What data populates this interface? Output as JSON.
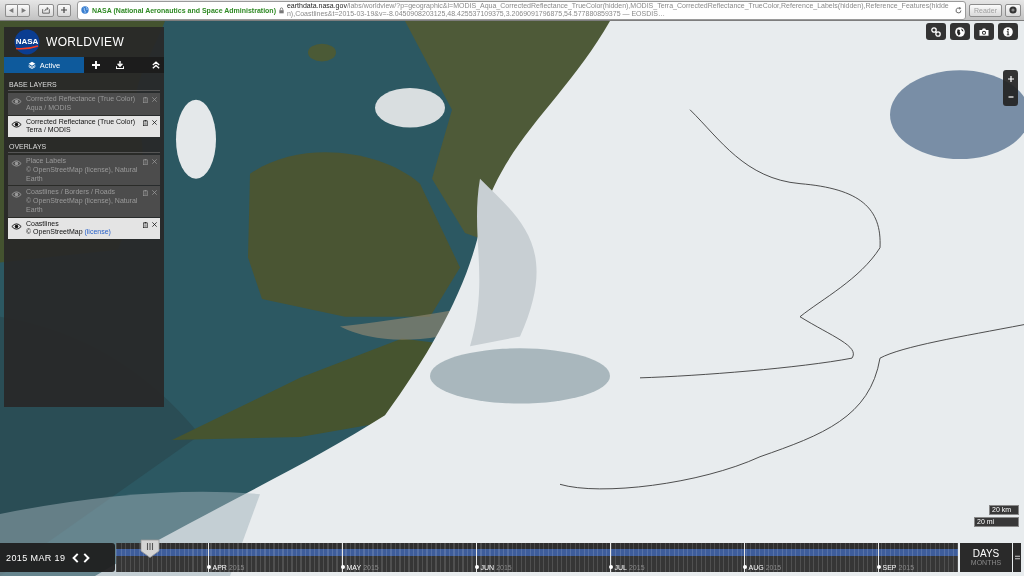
{
  "browser": {
    "site_identity": "NASA (National Aeronautics and Space Administration)",
    "url_domain": "earthdata.nasa.gov",
    "url_path": "/labs/worldview/?p=geographic&l=MODIS_Aqua_CorrectedReflectance_TrueColor(hidden),MODIS_Terra_CorrectedReflectance_TrueColor,Reference_Labels(hidden),Reference_Features(hidden),Coastlines&t=2015-03-19&v=-8.0450908203125,48.425537109375,3.2069091796875,54.577880859375 — EOSDIS…",
    "reader": {
      "label": "Reader",
      "disabled": true
    }
  },
  "app": {
    "logo_text": "NASA",
    "title": "WORLDVIEW"
  },
  "tabs": [
    {
      "kind": "text",
      "label": "Active",
      "selected": true
    },
    {
      "kind": "add",
      "selected": false
    },
    {
      "kind": "download",
      "selected": false
    }
  ],
  "layer_groups": [
    {
      "title": "BASE LAYERS",
      "layers": [
        {
          "name": "Corrected Reflectance (True Color)",
          "source": "Aqua / MODIS",
          "visible": false
        },
        {
          "name": "Corrected Reflectance (True Color)",
          "source": "Terra / MODIS",
          "visible": true
        }
      ]
    },
    {
      "title": "OVERLAYS",
      "layers": [
        {
          "name": "Place Labels",
          "source": "© OpenStreetMap",
          "link": "(license)",
          "source_end": ", Natural Earth",
          "visible": false
        },
        {
          "name": "Coastlines / Borders / Roads",
          "source": "© OpenStreetMap",
          "link": "(license)",
          "source_end": ", Natural Earth",
          "visible": false
        },
        {
          "name": "Coastlines",
          "source": "© OpenStreetMap",
          "link": "(license)",
          "visible": true
        }
      ]
    }
  ],
  "scale": [
    "20 km",
    "20 mi"
  ],
  "timeline": {
    "date": "2015 MAR 19",
    "level": 0.04,
    "months": [
      {
        "label": "APR",
        "year": "2015"
      },
      {
        "label": "MAY",
        "year": "2015"
      },
      {
        "label": "JUN",
        "year": "2015"
      },
      {
        "label": "JUL",
        "year": "2015"
      },
      {
        "label": "AUG",
        "year": "2015"
      },
      {
        "label": "SEP",
        "year": "2015"
      }
    ],
    "zoom_levels": [
      {
        "label": "DAYS",
        "selected": true
      },
      {
        "label": "MONTHS",
        "selected": false
      }
    ]
  }
}
